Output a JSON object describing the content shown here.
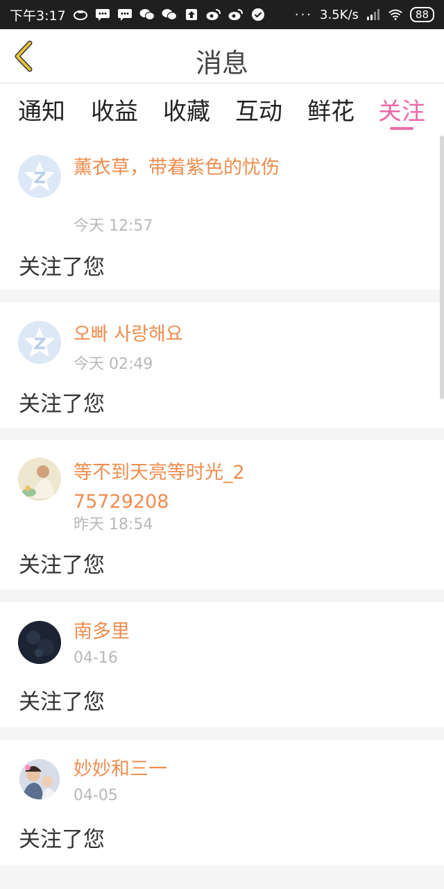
{
  "status_bar": {
    "time": "下午3:17",
    "network_speed": "3.5K/s",
    "battery": "88",
    "dots": "···"
  },
  "header": {
    "title": "消息"
  },
  "tabs": [
    {
      "label": "通知"
    },
    {
      "label": "收益"
    },
    {
      "label": "收藏"
    },
    {
      "label": "互动"
    },
    {
      "label": "鲜花"
    },
    {
      "label": "关注",
      "active": true
    }
  ],
  "notifications": [
    {
      "name": "薰衣草，带着紫色的忧伤",
      "time": "今天 12:57",
      "action": "关注了您"
    },
    {
      "name": "오빠 사랑해요",
      "time": "今天 02:49",
      "action": "关注了您"
    },
    {
      "name": "等不到天亮等时光_275729208",
      "time": "昨天 18:54",
      "action": "关注了您"
    },
    {
      "name": "南多里",
      "time": "04-16",
      "action": "关注了您"
    },
    {
      "name": "妙妙和三一",
      "time": "04-05",
      "action": "关注了您"
    }
  ],
  "colors": {
    "accent": "#ea6aa6",
    "username": "#ef8c4e",
    "back_arrow": "#e8c53a"
  }
}
